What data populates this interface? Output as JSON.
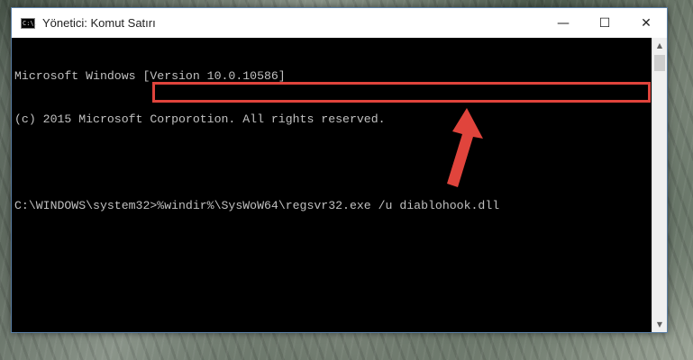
{
  "window": {
    "title": "Yönetici: Komut Satırı",
    "icon_label": "C:\\.",
    "controls": {
      "minimize": "—",
      "maximize": "☐",
      "close": "✕"
    }
  },
  "console": {
    "lines": [
      "Microsoft Windows [Version 10.0.10586]",
      "(c) 2015 Microsoft Corporotion. All rights reserved."
    ],
    "prompt": "C:\\WINDOWS\\system32>",
    "command": "%windir%\\SysWoW64\\regsvr32.exe /u diablohook.dll"
  },
  "colors": {
    "highlight": "#e0443c",
    "console_bg": "#000000",
    "console_text": "#c0c0c0"
  },
  "icons": {
    "app": "cmd-icon",
    "annotation": "red-arrow-icon",
    "scroll_up": "chevron-up-icon",
    "scroll_down": "chevron-down-icon"
  }
}
